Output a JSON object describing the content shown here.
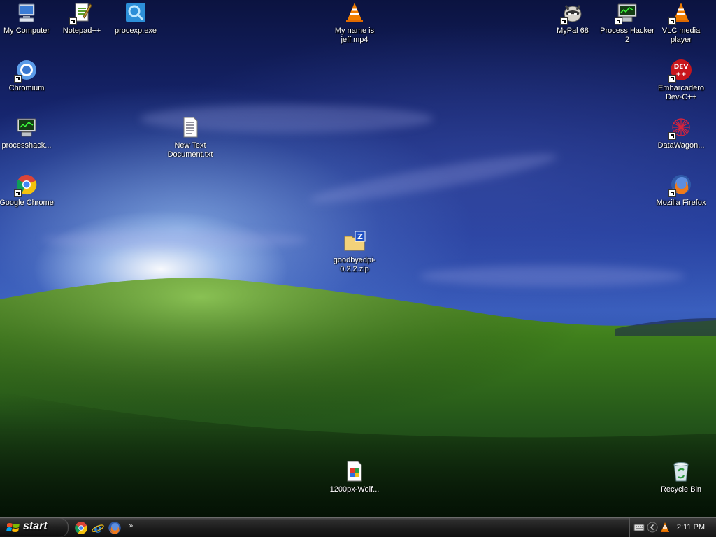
{
  "desktop": {
    "icons": [
      {
        "id": "my-computer",
        "label": "My Computer",
        "icon": "computer-icon"
      },
      {
        "id": "notepadpp",
        "label": "Notepad++",
        "icon": "notepad-plus-plus-icon",
        "shortcut": true
      },
      {
        "id": "procexp",
        "label": "procexp.exe",
        "icon": "process-explorer-icon"
      },
      {
        "id": "my-name-is-jeff",
        "label": "My name is jeff.mp4",
        "icon": "vlc-cone-icon"
      },
      {
        "id": "mypal",
        "label": "MyPal 68",
        "icon": "mypal-raccoon-icon",
        "shortcut": true
      },
      {
        "id": "process-hacker",
        "label": "Process Hacker 2",
        "icon": "process-hacker-icon",
        "shortcut": true
      },
      {
        "id": "vlc",
        "label": "VLC media player",
        "icon": "vlc-cone-icon",
        "shortcut": true
      },
      {
        "id": "chromium",
        "label": "Chromium",
        "icon": "chromium-icon",
        "shortcut": true
      },
      {
        "id": "devcpp",
        "label": "Embarcadero Dev-C++",
        "icon": "devcpp-icon",
        "shortcut": true
      },
      {
        "id": "processhack",
        "label": "processhack...",
        "icon": "process-hacker-icon"
      },
      {
        "id": "new-text",
        "label": "New Text Document.txt",
        "icon": "text-document-icon"
      },
      {
        "id": "datawagon",
        "label": "DataWagon...",
        "icon": "datawagon-icon",
        "shortcut": true
      },
      {
        "id": "chrome",
        "label": "Google Chrome",
        "icon": "chrome-icon",
        "shortcut": true
      },
      {
        "id": "firefox",
        "label": "Mozilla Firefox",
        "icon": "firefox-icon",
        "shortcut": true
      },
      {
        "id": "goodbyedpi",
        "label": "goodbyedpi-0.2.2.zip",
        "icon": "zip-folder-icon"
      },
      {
        "id": "wolf-image",
        "label": "1200px-Wolf...",
        "icon": "image-file-icon"
      },
      {
        "id": "recycle-bin",
        "label": "Recycle Bin",
        "icon": "recycle-bin-icon"
      }
    ]
  },
  "taskbar": {
    "start_label": "start",
    "quick_launch": [
      {
        "name": "chrome-icon"
      },
      {
        "name": "internet-explorer-icon"
      },
      {
        "name": "firefox-icon"
      }
    ],
    "overflow_label": "»",
    "tray": {
      "icons": [
        "keyboard-icon",
        "show-hidden-icons-chevron",
        "vlc-tray-icon"
      ],
      "clock": "2:11 PM"
    }
  },
  "colors": {
    "taskbar": "#1c1c1c",
    "label_text": "#ffffff",
    "sky_top": "#0b1340",
    "grass": "#3c7a1a"
  }
}
